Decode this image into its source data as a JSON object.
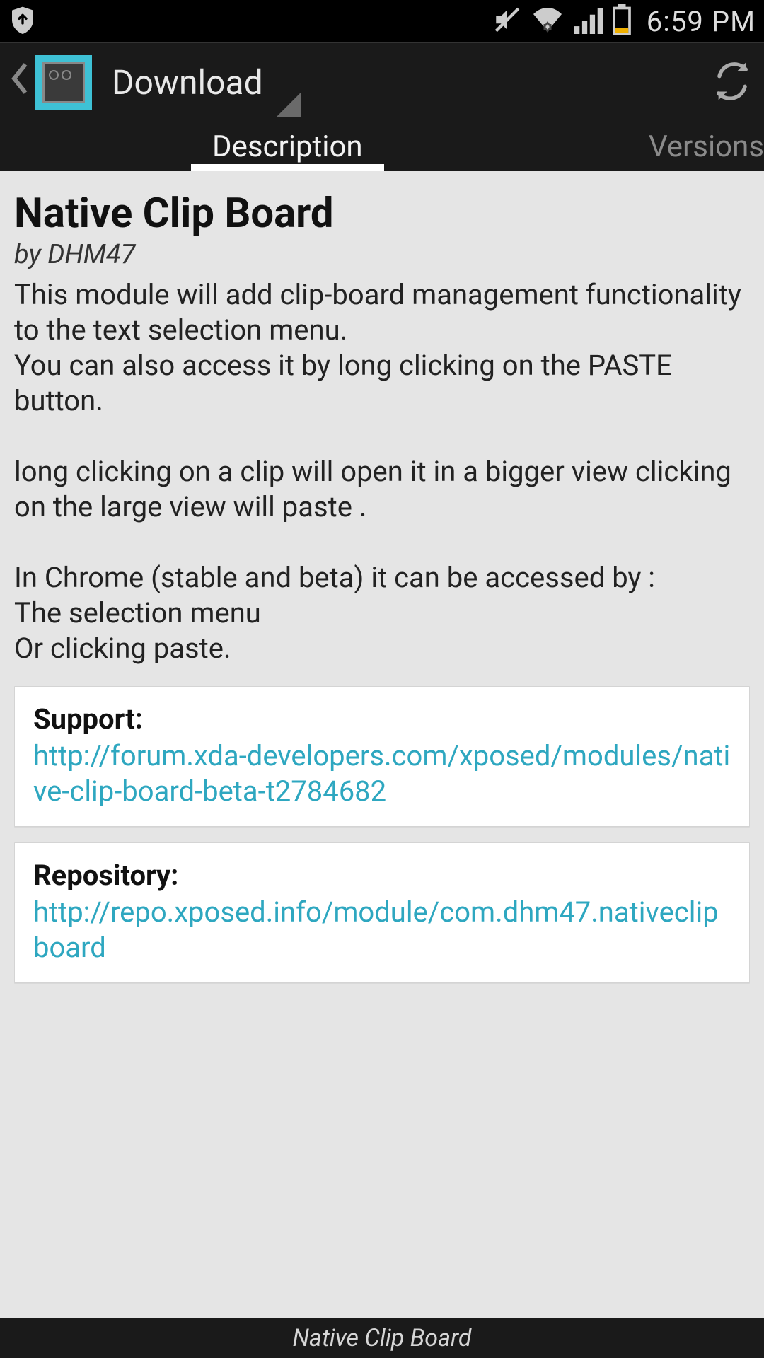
{
  "status": {
    "time": "6:59 PM"
  },
  "actionbar": {
    "title": "Download"
  },
  "tabs": {
    "description": "Description",
    "versions": "Versions"
  },
  "module": {
    "title": "Native Clip Board",
    "author": "by DHM47",
    "description": "This module will add clip-board management functionality to the text selection menu.\nYou can also access it by long clicking on the PASTE button.\n\nlong clicking on a clip will open it in a bigger view clicking on the large view will paste .\n\nIn Chrome (stable and beta) it can be accessed by :\nThe selection menu\nOr clicking paste."
  },
  "cards": {
    "support": {
      "label": "Support:",
      "link": "http://forum.xda-developers.com/xposed/modules/native-clip-board-beta-t2784682"
    },
    "repository": {
      "label": "Repository:",
      "link": "http://repo.xposed.info/module/com.dhm47.nativeclipboard"
    }
  },
  "footer": {
    "title": "Native Clip Board"
  }
}
